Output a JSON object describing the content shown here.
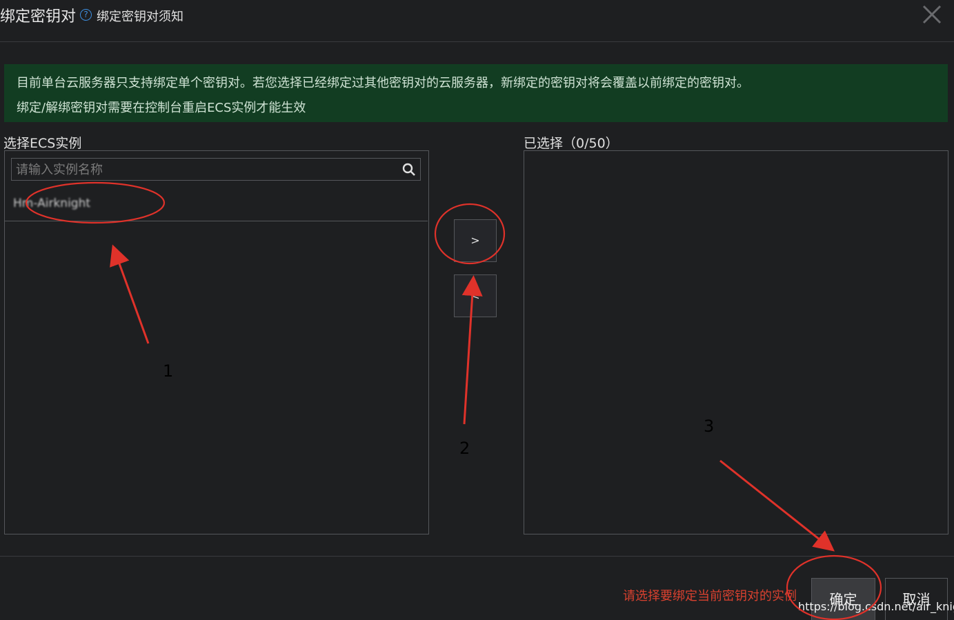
{
  "dialog": {
    "title": "绑定密钥对",
    "help_link": "绑定密钥对须知",
    "help_icon": "question-circle-icon",
    "close_icon": "close-icon"
  },
  "notice": {
    "line1": "目前单台云服务器只支持绑定单个密钥对。若您选择已经绑定过其他密钥对的云服务器，新绑定的密钥对将会覆盖以前绑定的密钥对。",
    "line2": "绑定/解绑密钥对需要在控制台重启ECS实例才能生效"
  },
  "left_panel": {
    "label": "选择ECS实例",
    "search_placeholder": "请输入实例名称",
    "items": [
      "Hm-Airknight"
    ]
  },
  "right_panel": {
    "label": "已选择（0/50）"
  },
  "transfer": {
    "add_label": ">",
    "remove_label": "<"
  },
  "footer": {
    "hint": "请选择要绑定当前密钥对的实例",
    "ok_label": "确定",
    "cancel_label": "取消"
  },
  "annotations": {
    "num1": "1",
    "num2": "2",
    "num3": "3",
    "color": "#e0322a"
  },
  "watermark": "https://blog.csdn.net/air_knight"
}
